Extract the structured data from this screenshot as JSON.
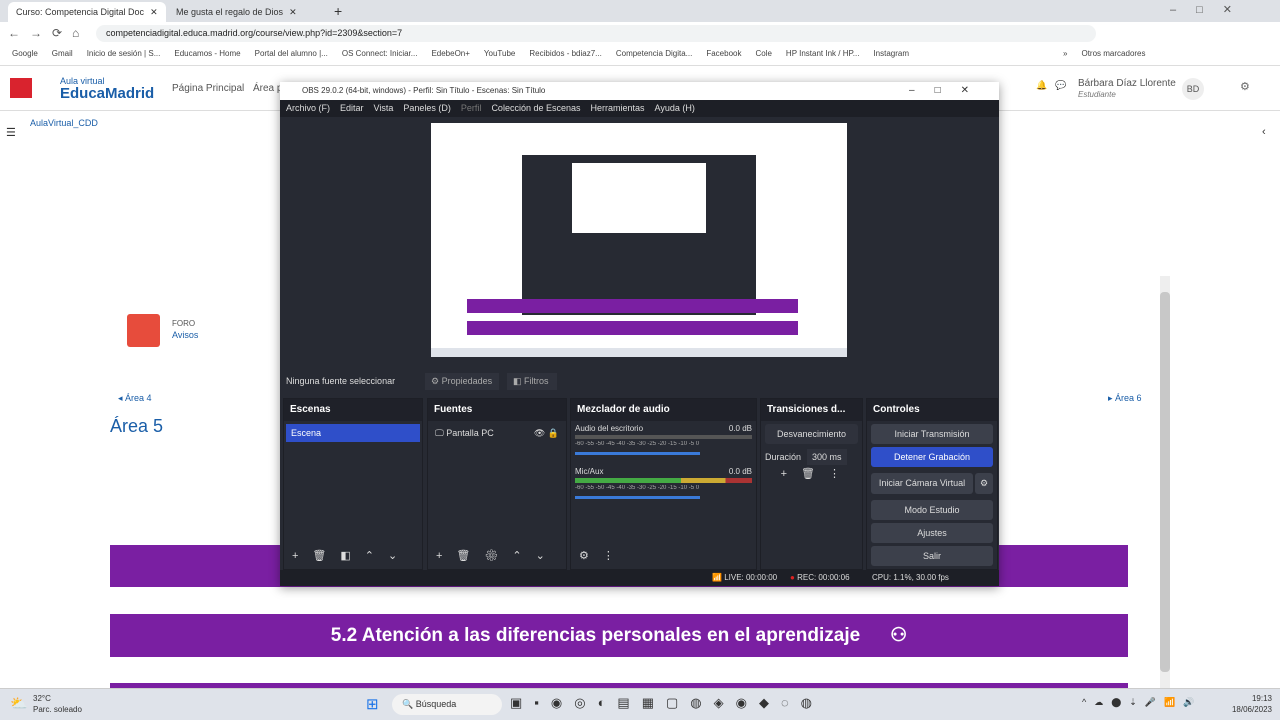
{
  "browser": {
    "tabs": [
      {
        "label": "Curso: Competencia Digital Doc"
      },
      {
        "label": "Me gusta el regalo de Dios"
      }
    ],
    "url": "competenciadigital.educa.madrid.org/course/view.php?id=2309&section=7",
    "bookmarks": [
      "Google",
      "Gmail",
      "Inicio de sesión | S...",
      "Educamos - Home",
      "Portal del alumno |...",
      "OS Connect: Iniciar...",
      "EdebeOn+",
      "YouTube",
      "Recibidos - bdiaz7...",
      "Competencia Digita...",
      "Facebook",
      "Cole",
      "HP Instant Ink / HP...",
      "Instagram",
      "»",
      "Otros marcadores"
    ]
  },
  "site": {
    "logo_top": "Aula virtual",
    "logo_main": "EducaMadrid",
    "nav": [
      "Página Principal",
      "Área p"
    ],
    "user_name": "Bárbara Díaz Llorente",
    "user_role": "Estudiante",
    "user_initials": "BD",
    "breadcrumb": "AulaVirtual_CDD",
    "forum_title": "FORO",
    "forum_name": "Avisos",
    "prev": "◂ Área 4",
    "next": "▸ Área 6",
    "section_title": "Área 5",
    "banner_text": "5.2 Atención a las diferencias personales en el aprendizaje",
    "accent": "#7a1fa2"
  },
  "obs": {
    "title": "OBS 29.0.2 (64-bit, windows) - Perfil: Sin Título - Escenas: Sin Título",
    "menu": [
      "Archivo (F)",
      "Editar",
      "Vista",
      "Paneles (D)",
      "Perfil",
      "Colección de Escenas",
      "Herramientas",
      "Ayuda (H)"
    ],
    "no_source": "Ninguna fuente seleccionar",
    "properties": "Propiedades",
    "filters": "Filtros",
    "scenes_title": "Escenas",
    "scenes": [
      "Escena"
    ],
    "sources_title": "Fuentes",
    "sources": [
      "Pantalla PC"
    ],
    "mixer_title": "Mezclador de audio",
    "channels": [
      {
        "name": "Audio del escritorio",
        "db": "0.0 dB"
      },
      {
        "name": "Mic/Aux",
        "db": "0.0 dB"
      }
    ],
    "meter_scale": "-60 -55 -50 -45 -40 -35 -30 -25 -20 -15 -10 -5 0",
    "transitions_title": "Transiciones d...",
    "transition": "Desvanecimiento",
    "duration_label": "Duración",
    "duration": "300 ms",
    "controls_title": "Controles",
    "controls": [
      "Iniciar Transmisión",
      "Detener Grabación",
      "Iniciar Cámara Virtual",
      "Modo Estudio",
      "Ajustes",
      "Salir"
    ],
    "live": "LIVE: 00:00:00",
    "rec": "REC: 00:00:06",
    "cpu": "CPU: 1.1%, 30.00 fps",
    "active_color": "#2f4fc9"
  },
  "taskbar": {
    "weather_temp": "32°C",
    "weather_desc": "Parc. soleado",
    "search": "Búsqueda",
    "time": "19:13",
    "date": "18/06/2023"
  }
}
